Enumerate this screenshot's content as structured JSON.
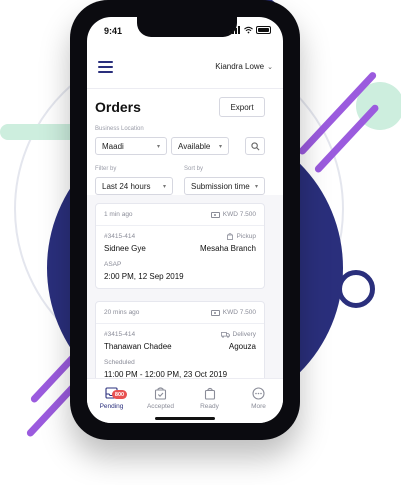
{
  "status_bar": {
    "time": "9:41"
  },
  "header": {
    "user_name": "Kiandra Lowe"
  },
  "page": {
    "title": "Orders",
    "export_label": "Export"
  },
  "filters": {
    "business_location_label": "Business Location",
    "location_value": "Maadi",
    "availability_value": "Available",
    "filter_by_label": "Filter by",
    "filter_by_value": "Last 24 hours",
    "sort_by_label": "Sort by",
    "sort_by_value": "Submission time"
  },
  "orders": [
    {
      "time_ago": "1 min ago",
      "price": "KWD 7.500",
      "order_id": "#3415-414",
      "type": "Pickup",
      "customer": "Sidnee Gye",
      "branch": "Mesaha Branch",
      "schedule_label": "ASAP",
      "schedule_time": "2:00 PM, 12 Sep 2019"
    },
    {
      "time_ago": "20 mins ago",
      "price": "KWD 7.500",
      "order_id": "#3415-414",
      "type": "Delivery",
      "customer": "Thanawan Chadee",
      "branch": "Agouza",
      "schedule_label": "Scheduled",
      "schedule_time": "11:00 PM - 12:00 PM, 23 Oct 2019"
    }
  ],
  "tabs": [
    {
      "label": "Pending",
      "icon": "inbox-icon",
      "badge": "800",
      "active": true
    },
    {
      "label": "Accepted",
      "icon": "check-bag-icon"
    },
    {
      "label": "Ready",
      "icon": "bag-icon"
    },
    {
      "label": "More",
      "icon": "more-icon"
    }
  ],
  "colors": {
    "primary": "#2a2f7c",
    "accent": "#9b5bde",
    "mint": "#cdeede",
    "badge": "#e85252"
  }
}
